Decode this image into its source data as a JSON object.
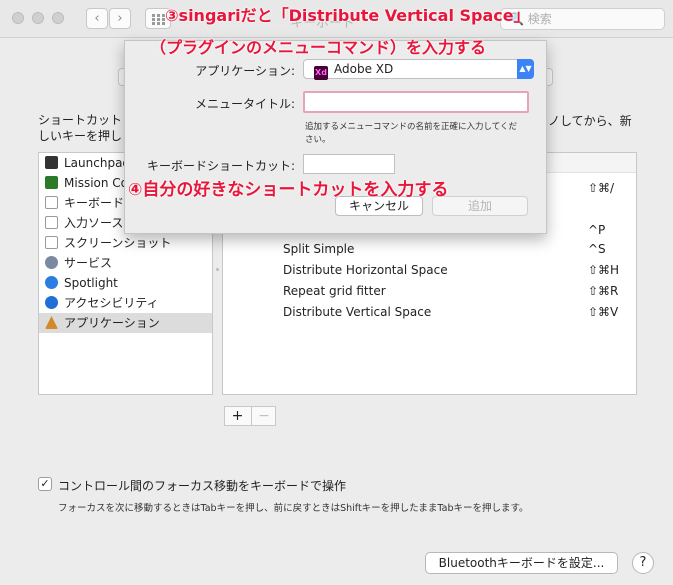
{
  "window": {
    "title": "キーボード",
    "search_placeholder": "検索"
  },
  "annotations": {
    "step3_line1": "③singariだと「Distribute Vertical Space」",
    "step3_line2": "（プラグインのメニューコマンド）を入力する",
    "step4": "④自分の好きなショートカットを入力する"
  },
  "description": {
    "left": "ショートカットしいキーを押し",
    "right": "ノしてから、新"
  },
  "sidebar": {
    "items": [
      {
        "label": "Launchpad",
        "icon": "launchpad-icon",
        "color": "#333333"
      },
      {
        "label": "Mission Control",
        "icon": "mission-control-icon",
        "color": "#2a7a2a"
      },
      {
        "label": "キーボード",
        "icon": "keyboard-icon",
        "color": "#9a9a9a"
      },
      {
        "label": "入力ソース",
        "icon": "input-source-icon",
        "color": "#9a9a9a"
      },
      {
        "label": "スクリーンショット",
        "icon": "screenshot-icon",
        "color": "#9a9a9a"
      },
      {
        "label": "サービス",
        "icon": "gear-icon",
        "color": "#7a8aa0"
      },
      {
        "label": "Spotlight",
        "icon": "spotlight-icon",
        "color": "#2a7de1"
      },
      {
        "label": "アクセシビリティ",
        "icon": "accessibility-icon",
        "color": "#1f6fd6"
      },
      {
        "label": "アプリケーション",
        "icon": "applications-icon",
        "color": "#d08a2a"
      }
    ],
    "selected_index": 8
  },
  "shortcuts": {
    "rows": [
      {
        "name": "",
        "shortcut": "⇧⌘/"
      },
      {
        "name": "",
        "shortcut": "^P"
      },
      {
        "name": "Split Simple",
        "shortcut": "^S"
      },
      {
        "name": "Distribute Horizontal Space",
        "shortcut": "⇧⌘H"
      },
      {
        "name": "Repeat grid fitter",
        "shortcut": "⇧⌘R"
      },
      {
        "name": "Distribute Vertical Space",
        "shortcut": "⇧⌘V"
      }
    ]
  },
  "controls": {
    "plus": "+",
    "minus": "−",
    "focus_checkbox_mark": "✓",
    "focus_checkbox_label": "コントロール間のフォーカス移動をキーボードで操作",
    "focus_help": "フォーカスを次に移動するときはTabキーを押し、前に戻すときはShiftキーを押したままTabキーを押します。",
    "bluetooth_button": "Bluetoothキーボードを設定...",
    "help_button": "?"
  },
  "dialog": {
    "app_label": "アプリケーション:",
    "app_value": "Adobe XD",
    "app_icon_text": "Xd",
    "menu_title_label": "メニュータイトル:",
    "menu_title_value": "",
    "hint": "追加するメニューコマンドの名前を正確に入力してください。",
    "shortcut_label": "キーボードショートカット:",
    "cancel": "キャンセル",
    "add": "追加"
  },
  "colors": {
    "annotation": "#e8163a",
    "focus_ring": "#e6a3c0",
    "popup_arrow": "#3b84f5"
  }
}
